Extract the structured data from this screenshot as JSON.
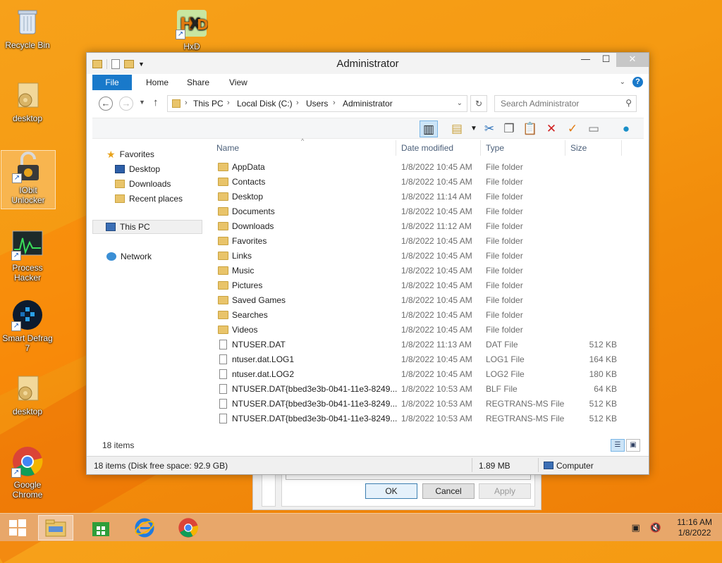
{
  "desktop": {
    "icons": [
      {
        "label": "Recycle Bin"
      },
      {
        "label": "HxD"
      },
      {
        "label": "desktop"
      },
      {
        "label": "IObit Unlocker"
      },
      {
        "label": "Process Hacker"
      },
      {
        "label": "Smart Defrag 7"
      },
      {
        "label": "desktop"
      },
      {
        "label": "Google Chrome"
      }
    ]
  },
  "background_dialog": {
    "ok_label": "OK",
    "cancel_label": "Cancel",
    "apply_label": "Apply"
  },
  "window": {
    "title": "Administrator",
    "ribbon_tabs": [
      "File",
      "Home",
      "Share",
      "View"
    ],
    "breadcrumb": [
      "This PC",
      "Local Disk (C:)",
      "Users",
      "Administrator"
    ],
    "search_placeholder": "Search Administrator",
    "nav": {
      "favorites": "Favorites",
      "favorites_items": [
        "Desktop",
        "Downloads",
        "Recent places"
      ],
      "this_pc": "This PC",
      "network": "Network"
    },
    "columns": [
      "Name",
      "Date modified",
      "Type",
      "Size"
    ],
    "files": [
      {
        "name": "AppData",
        "date": "1/8/2022 10:45 AM",
        "type": "File folder",
        "size": "",
        "kind": "folder"
      },
      {
        "name": "Contacts",
        "date": "1/8/2022 10:45 AM",
        "type": "File folder",
        "size": "",
        "kind": "folder"
      },
      {
        "name": "Desktop",
        "date": "1/8/2022 11:14 AM",
        "type": "File folder",
        "size": "",
        "kind": "folder"
      },
      {
        "name": "Documents",
        "date": "1/8/2022 10:45 AM",
        "type": "File folder",
        "size": "",
        "kind": "folder"
      },
      {
        "name": "Downloads",
        "date": "1/8/2022 11:12 AM",
        "type": "File folder",
        "size": "",
        "kind": "folder"
      },
      {
        "name": "Favorites",
        "date": "1/8/2022 10:45 AM",
        "type": "File folder",
        "size": "",
        "kind": "folder"
      },
      {
        "name": "Links",
        "date": "1/8/2022 10:45 AM",
        "type": "File folder",
        "size": "",
        "kind": "folder"
      },
      {
        "name": "Music",
        "date": "1/8/2022 10:45 AM",
        "type": "File folder",
        "size": "",
        "kind": "folder"
      },
      {
        "name": "Pictures",
        "date": "1/8/2022 10:45 AM",
        "type": "File folder",
        "size": "",
        "kind": "folder"
      },
      {
        "name": "Saved Games",
        "date": "1/8/2022 10:45 AM",
        "type": "File folder",
        "size": "",
        "kind": "folder"
      },
      {
        "name": "Searches",
        "date": "1/8/2022 10:45 AM",
        "type": "File folder",
        "size": "",
        "kind": "folder"
      },
      {
        "name": "Videos",
        "date": "1/8/2022 10:45 AM",
        "type": "File folder",
        "size": "",
        "kind": "folder"
      },
      {
        "name": "NTUSER.DAT",
        "date": "1/8/2022 11:13 AM",
        "type": "DAT File",
        "size": "512 KB",
        "kind": "file"
      },
      {
        "name": "ntuser.dat.LOG1",
        "date": "1/8/2022 10:45 AM",
        "type": "LOG1 File",
        "size": "164 KB",
        "kind": "file"
      },
      {
        "name": "ntuser.dat.LOG2",
        "date": "1/8/2022 10:45 AM",
        "type": "LOG2 File",
        "size": "180 KB",
        "kind": "file"
      },
      {
        "name": "NTUSER.DAT{bbed3e3b-0b41-11e3-8249...",
        "date": "1/8/2022 10:53 AM",
        "type": "BLF File",
        "size": "64 KB",
        "kind": "file"
      },
      {
        "name": "NTUSER.DAT{bbed3e3b-0b41-11e3-8249...",
        "date": "1/8/2022 10:53 AM",
        "type": "REGTRANS-MS File",
        "size": "512 KB",
        "kind": "file"
      },
      {
        "name": "NTUSER.DAT{bbed3e3b-0b41-11e3-8249...",
        "date": "1/8/2022 10:53 AM",
        "type": "REGTRANS-MS File",
        "size": "512 KB",
        "kind": "file"
      }
    ],
    "item_count": "18 items",
    "status_items": "18 items (Disk free space: 92.9 GB)",
    "status_size": "1.89 MB",
    "status_location": "Computer"
  },
  "taskbar": {
    "time": "11:16 AM",
    "date": "1/8/2022"
  },
  "colors": {
    "accent": "#1979ca",
    "folder": "#e9c46a",
    "desktop_bg": "#f59a12"
  }
}
